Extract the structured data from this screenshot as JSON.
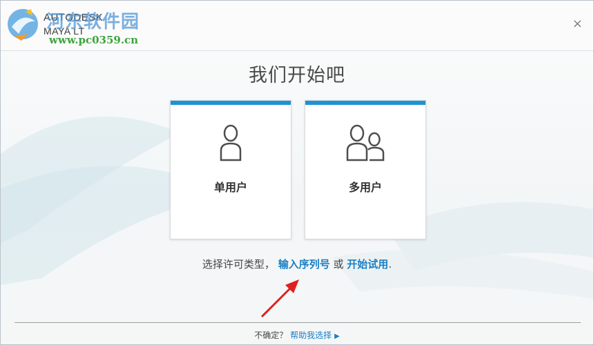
{
  "header": {
    "brand_line1": "AUTODESK",
    "brand_line2": "MAYA LT",
    "watermark_title": "河东软件园",
    "watermark_url": "www.pc0359.cn",
    "close_glyph": "×"
  },
  "main": {
    "heading": "我们开始吧",
    "cards": [
      {
        "label": "单用户",
        "icon": "single-user-icon"
      },
      {
        "label": "多用户",
        "icon": "multi-user-icon"
      }
    ],
    "choose_text": "选择许可类型，",
    "serial_link": "输入序列号",
    "or_text": "或",
    "trial_link": "开始试用",
    "period": "."
  },
  "footer": {
    "unsure_text": "不确定？",
    "help_link": "帮助我选择"
  },
  "colors": {
    "accent": "#1e92d4",
    "link": "#1b7fc4",
    "arrow": "#e02020",
    "watermark_url": "#3da33d"
  }
}
